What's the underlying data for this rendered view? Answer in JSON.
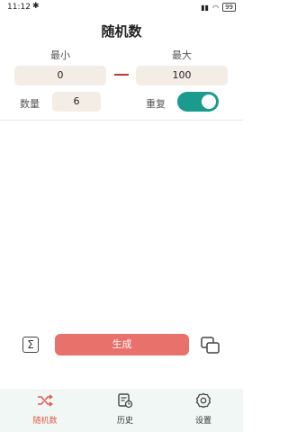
{
  "status": {
    "time": "11:12",
    "battery": "99"
  },
  "page": {
    "title": "随机数"
  },
  "range": {
    "min_label": "最小",
    "max_label": "最大",
    "min_value": "0",
    "max_value": "100"
  },
  "count": {
    "label": "数量",
    "value": "6"
  },
  "repeat": {
    "label": "重复",
    "enabled": true
  },
  "actions": {
    "sum_icon": "Σ",
    "generate_label": "生成"
  },
  "nav": {
    "items": [
      {
        "label": "随机数",
        "icon": "shuffle-icon",
        "active": true
      },
      {
        "label": "历史",
        "icon": "history-icon",
        "active": false
      },
      {
        "label": "设置",
        "icon": "gear-icon",
        "active": false
      }
    ]
  },
  "colors": {
    "accent": "#e8716c",
    "toggle": "#1b9a8e",
    "nav_active": "#e05a4f",
    "field_bg": "#f3ede6"
  }
}
